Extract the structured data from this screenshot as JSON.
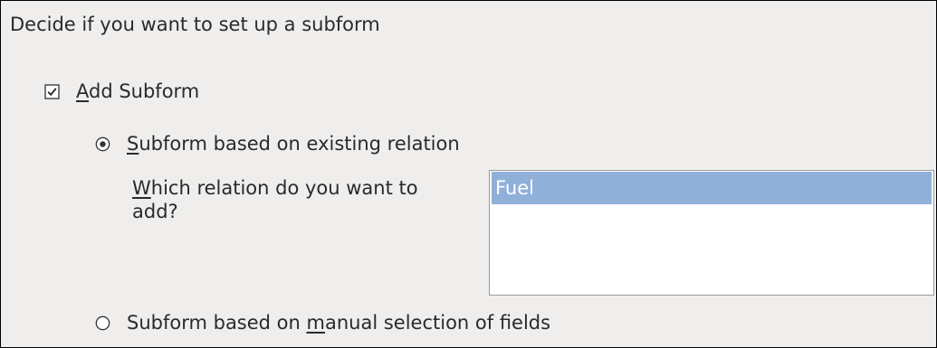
{
  "heading": "Decide if you want to set up a subform",
  "add_subform": {
    "mnemonic": "A",
    "rest": "dd Subform",
    "checked": true
  },
  "option_existing": {
    "mnemonic": "S",
    "rest": "ubform based on existing relation",
    "selected": true
  },
  "relation_question": {
    "mnemonic": "W",
    "rest": "hich relation do you want to add?"
  },
  "relations_list": {
    "items": [
      "Fuel"
    ],
    "selected_item": "Fuel"
  },
  "option_manual": {
    "prefix": "Subform based on ",
    "mnemonic": "m",
    "suffix": "anual selection of fields",
    "selected": false
  },
  "colors": {
    "panel_bg": "#efeeed",
    "selection_bg": "#8fb0d9",
    "text": "#2a2a2a"
  }
}
